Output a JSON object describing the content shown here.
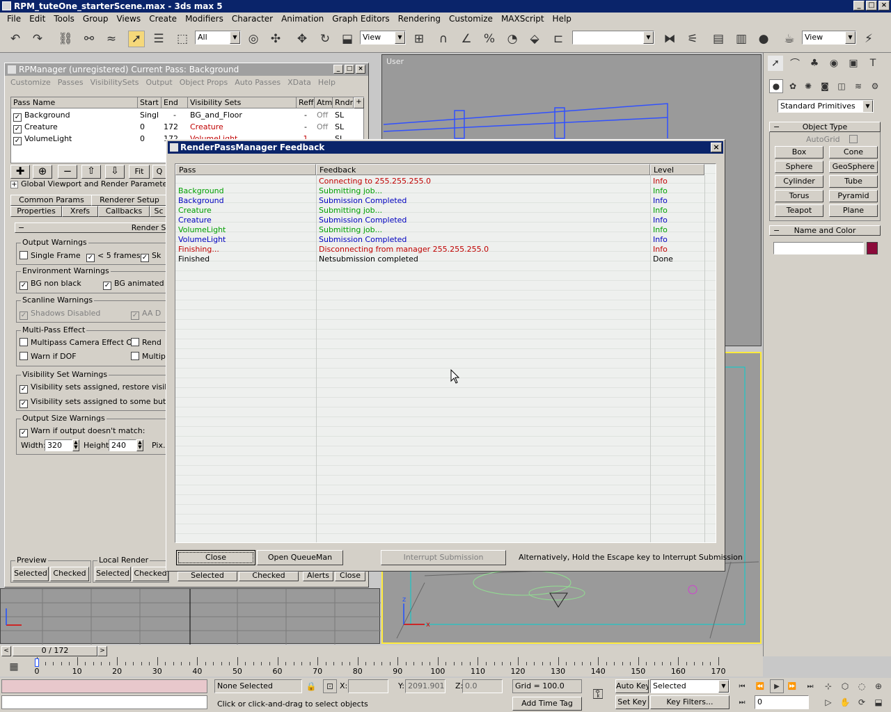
{
  "app": {
    "title": "RPM_tuteOne_starterScene.max - 3ds max 5",
    "menu": [
      "File",
      "Edit",
      "Tools",
      "Group",
      "Views",
      "Create",
      "Modifiers",
      "Character",
      "Animation",
      "Graph Editors",
      "Rendering",
      "Customize",
      "MAXScript",
      "Help"
    ]
  },
  "toolbar": {
    "selection_filter": "All",
    "ref_coord": "View",
    "named_sets": "",
    "view_combo": "View"
  },
  "viewports": {
    "top_label": "User"
  },
  "rpm": {
    "title": "RPManager (unregistered)  Current Pass: Background",
    "menu": [
      "Customize",
      "Passes",
      "VisibilitySets",
      "Output",
      "Object Props",
      "Auto Passes",
      "XData",
      "Help"
    ],
    "columns": [
      "Pass Name",
      "Start",
      "End",
      "Visibility Sets",
      "Reff",
      "Atm",
      "Rndr"
    ],
    "rows": [
      {
        "name": "Background",
        "start": "Singl",
        "end": "-",
        "vis": "BG_and_Floor",
        "reff": "-",
        "atm": "Off",
        "rndr": "SL"
      },
      {
        "name": "Creature",
        "start": "0",
        "end": "172",
        "vis": "Creature",
        "reff": "-",
        "atm": "Off",
        "rndr": "SL"
      },
      {
        "name": "VolumeLight",
        "start": "0",
        "end": "172",
        "vis": "VolumeLight",
        "reff": "1",
        "atm": "",
        "rndr": "SL"
      }
    ],
    "fit_label": "Fit",
    "q_label": "Q",
    "global_params": "Global Viewport and Render Parameters",
    "tabs": [
      "Common Params",
      "Renderer Setup",
      "Properties",
      "Xrefs",
      "Callbacks",
      "Sc"
    ],
    "render_summary": "Render Su",
    "output_warnings": {
      "label": "Output Warnings",
      "single_frame": "Single Frame",
      "lt5": "< 5 frames",
      "sk": "Sk"
    },
    "env_warnings": {
      "label": "Environment Warnings",
      "bg_non_black": "BG non black",
      "bg_animated": "BG animated"
    },
    "scanline_warnings": {
      "label": "Scanline Warnings",
      "shadows": "Shadows Disabled",
      "aa": "AA D"
    },
    "multipass": {
      "label": "Multi-Pass Effect",
      "camera_off": "Multipass Camera Effect Off",
      "rend": "Rend",
      "warn_dof": "Warn if DOF",
      "multip": "Multip"
    },
    "visset_warnings": {
      "label": "Visibility Set Warnings",
      "assigned_restore": "Visibility sets assigned, restore visibility s",
      "assigned_some": "Visibility sets assigned to some but not a"
    },
    "output_size": {
      "label": "Output Size Warnings",
      "warn": "Warn if output doesn't match:",
      "width_label": "Width:",
      "width": "320",
      "height_label": "Height:",
      "height": "240",
      "pix": "Pix."
    },
    "preview": {
      "label": "Preview",
      "selected": "Selected",
      "checked": "Checked"
    },
    "local_render": {
      "label": "Local Render",
      "selected": "Selected",
      "checked": "Checked"
    },
    "net": {
      "selected": "Selected",
      "checked": "Checked",
      "alerts": "Alerts",
      "close": "Close"
    }
  },
  "dialog": {
    "title": "RenderPassManager Feedback",
    "columns": [
      "Pass",
      "Feedback",
      "Level"
    ],
    "rows": [
      {
        "pass": "",
        "feedback": "Connecting to 255.255.255.0",
        "level": "Info",
        "pcolor": "#000000",
        "fcolor": "#c00000",
        "lcolor": "#c00000"
      },
      {
        "pass": "Background",
        "feedback": "Submitting job...",
        "level": "Info",
        "pcolor": "#00a000",
        "fcolor": "#00a000",
        "lcolor": "#00a000"
      },
      {
        "pass": "Background",
        "feedback": "Submission Completed",
        "level": "Info",
        "pcolor": "#0000c0",
        "fcolor": "#0000c0",
        "lcolor": "#0000c0"
      },
      {
        "pass": "Creature",
        "feedback": "Submitting job...",
        "level": "Info",
        "pcolor": "#00a000",
        "fcolor": "#00a000",
        "lcolor": "#00a000"
      },
      {
        "pass": "Creature",
        "feedback": "Submission Completed",
        "level": "Info",
        "pcolor": "#0000c0",
        "fcolor": "#0000c0",
        "lcolor": "#0000c0"
      },
      {
        "pass": "VolumeLight",
        "feedback": "Submitting job...",
        "level": "Info",
        "pcolor": "#00a000",
        "fcolor": "#00a000",
        "lcolor": "#00a000"
      },
      {
        "pass": "VolumeLight",
        "feedback": "Submission Completed",
        "level": "Info",
        "pcolor": "#0000c0",
        "fcolor": "#0000c0",
        "lcolor": "#0000c0"
      },
      {
        "pass": "Finishing...",
        "feedback": "Disconnecting from manager 255.255.255.0",
        "level": "Info",
        "pcolor": "#c00000",
        "fcolor": "#c00000",
        "lcolor": "#c00000"
      },
      {
        "pass": "Finished",
        "feedback": "Netsubmission completed",
        "level": "Done",
        "pcolor": "#000000",
        "fcolor": "#000000",
        "lcolor": "#000000"
      }
    ],
    "close_label": "Close",
    "queueman_label": "Open QueueMan",
    "interrupt_label": "Interrupt Submission",
    "hint": "Alternatively, Hold the Escape key  to Interrupt Submission"
  },
  "command_panel": {
    "category": "Standard Primitives",
    "object_type": "Object Type",
    "autogrid": "AutoGrid",
    "buttons": [
      "Box",
      "Cone",
      "Sphere",
      "GeoSphere",
      "Cylinder",
      "Tube",
      "Torus",
      "Pyramid",
      "Teapot",
      "Plane"
    ],
    "name_color": "Name and Color",
    "name_value": "",
    "swatch_color": "#8b0a3a"
  },
  "timeline": {
    "frame": "0 / 172",
    "ticks": [
      "0",
      "10",
      "20",
      "30",
      "40",
      "50",
      "60",
      "70",
      "80",
      "90",
      "100",
      "110",
      "120",
      "130",
      "140",
      "150",
      "160",
      "170"
    ]
  },
  "status": {
    "selection": "None Selected",
    "x_label": "X:",
    "x_value": "",
    "y_label": "Y:",
    "y_value": "2091.901",
    "z_label": "Z:",
    "z_value": "0.0",
    "grid": "Grid = 100.0",
    "prompt": "Click or click-and-drag to select objects",
    "add_time_tag": "Add Time Tag",
    "auto_key": "Auto Key",
    "set_key": "Set Key",
    "key_mode": "Selected",
    "key_filters": "Key Filters...",
    "current_frame": "0"
  }
}
